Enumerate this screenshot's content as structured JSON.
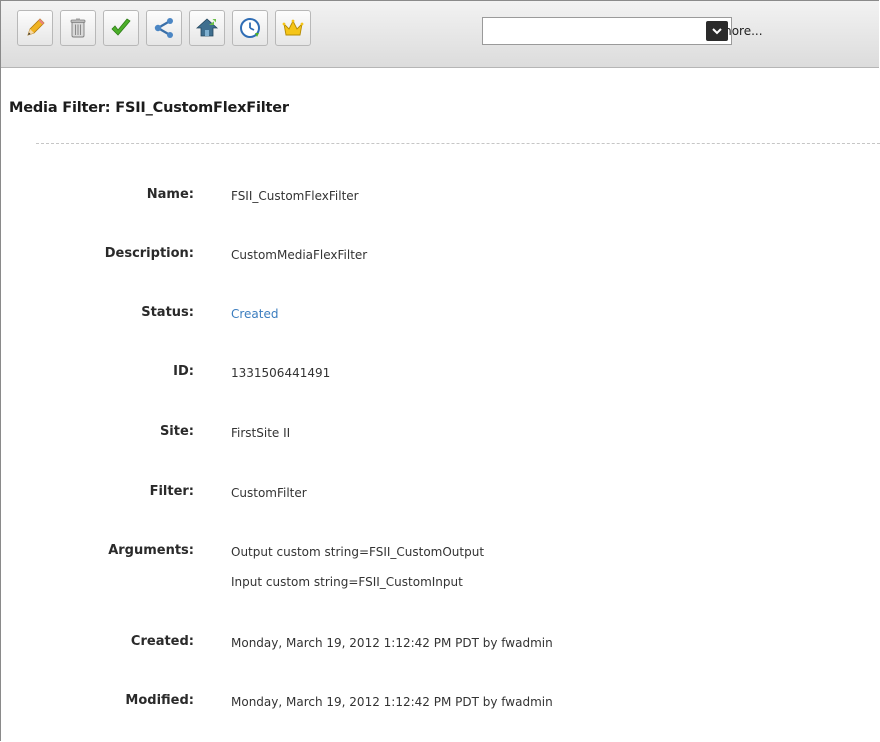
{
  "toolbar": {
    "buttons": [
      {
        "icon": "pencil-icon",
        "name": "edit-button"
      },
      {
        "icon": "trash-icon",
        "name": "delete-button"
      },
      {
        "icon": "checkmark-icon",
        "name": "approve-button"
      },
      {
        "icon": "share-icon",
        "name": "share-button"
      },
      {
        "icon": "home-up-icon",
        "name": "preview-button"
      },
      {
        "icon": "clock-icon",
        "name": "history-button"
      },
      {
        "icon": "crown-icon",
        "name": "tag-button"
      }
    ],
    "more_select": {
      "value": "more..."
    }
  },
  "page": {
    "title": "Media Filter: FSII_CustomFlexFilter"
  },
  "fields": {
    "name": {
      "label": "Name:",
      "value": "FSII_CustomFlexFilter"
    },
    "description": {
      "label": "Description:",
      "value": "CustomMediaFlexFilter"
    },
    "status": {
      "label": "Status:",
      "value": "Created"
    },
    "id": {
      "label": "ID:",
      "value": "1331506441491"
    },
    "site": {
      "label": "Site:",
      "value": "FirstSite II"
    },
    "filter": {
      "label": "Filter:",
      "value": "CustomFilter"
    },
    "arguments": {
      "label": "Arguments:",
      "values": [
        "Output custom string=FSII_CustomOutput",
        "Input custom string=FSII_CustomInput"
      ]
    },
    "created": {
      "label": "Created:",
      "value": "Monday, March 19, 2012 1:12:42 PM PDT by fwadmin"
    },
    "modified": {
      "label": "Modified:",
      "value": "Monday, March 19, 2012 1:12:42 PM PDT by fwadmin"
    }
  },
  "colors": {
    "status_link": "#3b7dbf",
    "check_green": "#4caf2a",
    "toolbar_bg": "#e6e6e6"
  }
}
